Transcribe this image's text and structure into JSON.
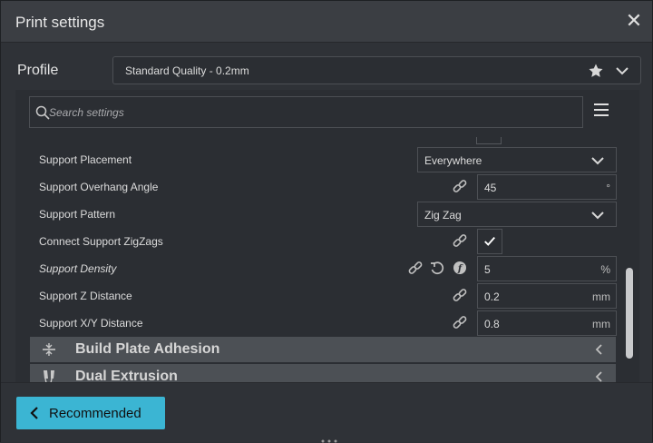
{
  "window": {
    "title": "Print settings"
  },
  "profile": {
    "label": "Profile",
    "value": "Standard Quality - 0.2mm"
  },
  "search": {
    "placeholder": "Search settings",
    "value": ""
  },
  "settings": {
    "support_placement": {
      "label": "Support Placement",
      "value": "Everywhere"
    },
    "support_overhang_angle": {
      "label": "Support Overhang Angle",
      "value": "45",
      "unit": "°"
    },
    "support_pattern": {
      "label": "Support Pattern",
      "value": "Zig Zag"
    },
    "connect_support_zigzags": {
      "label": "Connect Support ZigZags",
      "checked": true
    },
    "support_density": {
      "label": "Support Density",
      "value": "5",
      "unit": "%"
    },
    "support_z_distance": {
      "label": "Support Z Distance",
      "value": "0.2",
      "unit": "mm"
    },
    "support_xy_distance": {
      "label": "Support X/Y Distance",
      "value": "0.8",
      "unit": "mm"
    }
  },
  "sections": [
    {
      "label": "Build Plate Adhesion",
      "icon": "build-plate-adhesion-icon"
    },
    {
      "label": "Dual Extrusion",
      "icon": "dual-extrusion-icon"
    }
  ],
  "footer": {
    "recommended_label": "Recommended"
  },
  "colors": {
    "accent": "#3bb5d3",
    "background": "#2f3237",
    "section": "#4c5055"
  },
  "icons": {
    "close": "close-icon",
    "star": "star-icon",
    "chevron": "chevron-down-icon",
    "search": "search-icon",
    "menu": "hamburger-menu-icon",
    "link": "link-icon",
    "reset": "reset-icon",
    "function": "function-icon",
    "check": "checkmark-icon"
  }
}
